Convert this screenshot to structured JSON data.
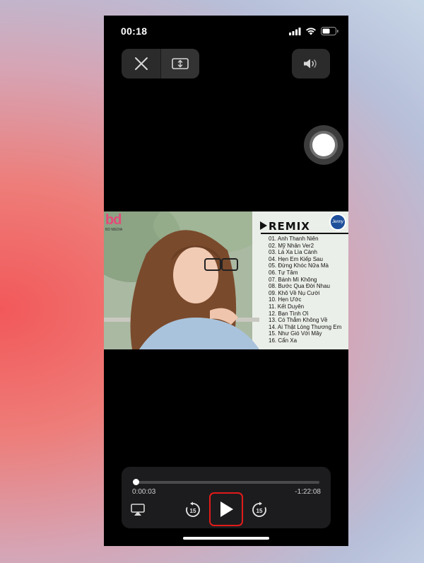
{
  "status_bar": {
    "time": "00:18"
  },
  "video": {
    "logo_text": "bd",
    "logo_subtext": "BD MEDIA",
    "badge_text": "Jenny",
    "remix_title": "REMIX",
    "tracks": [
      "01. Anh Thanh Niên",
      "02. Mỹ Nhân Ver2",
      "03. Lá Xa Lìa Cành",
      "04. Hẹn Em Kiếp Sau",
      "05. Đừng Khóc Nữa Mà",
      "06. Tự Tâm",
      "07. Bánh Mì Không",
      "08. Bước Qua Đời Nhau",
      "09. Khô Về Nụ Cười",
      "10. Hẹn Ước",
      "11. Kết Duyên",
      "12. Bạn Tình Ơi",
      "13. Có Thắm Không Về",
      "14. Ai Thật Lòng Thương Em",
      "15. Như Gió Với Mây",
      "16. Cẩn Xa"
    ]
  },
  "player": {
    "elapsed": "0:00:03",
    "remaining": "-1:22:08",
    "progress": 0.0006,
    "skip_back_seconds": "15",
    "skip_forward_seconds": "15"
  },
  "icons": {
    "close": "close-icon",
    "aspect": "fit-screen-icon",
    "volume": "speaker-icon",
    "airplay": "airplay-icon",
    "play": "play-icon",
    "skip_back": "skip-back-15-icon",
    "skip_forward": "skip-forward-15-icon"
  },
  "colors": {
    "highlight": "#e21b1b",
    "panel": "#1c1c1e"
  }
}
